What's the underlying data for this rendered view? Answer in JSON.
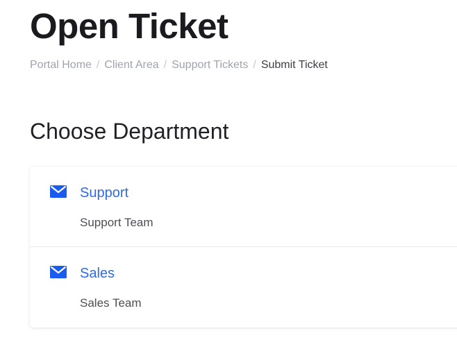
{
  "header": {
    "title": "Open Ticket"
  },
  "breadcrumb": {
    "items": [
      "Portal Home",
      "Client Area",
      "Support Tickets"
    ],
    "separator": "/",
    "current": "Submit Ticket"
  },
  "section": {
    "title": "Choose Department"
  },
  "departments": [
    {
      "name": "Support",
      "description": "Support Team",
      "icon": "envelope-icon"
    },
    {
      "name": "Sales",
      "description": "Sales Team",
      "icon": "envelope-icon"
    }
  ],
  "colors": {
    "accent": "#1a5cf0",
    "link": "#2f6be0"
  }
}
